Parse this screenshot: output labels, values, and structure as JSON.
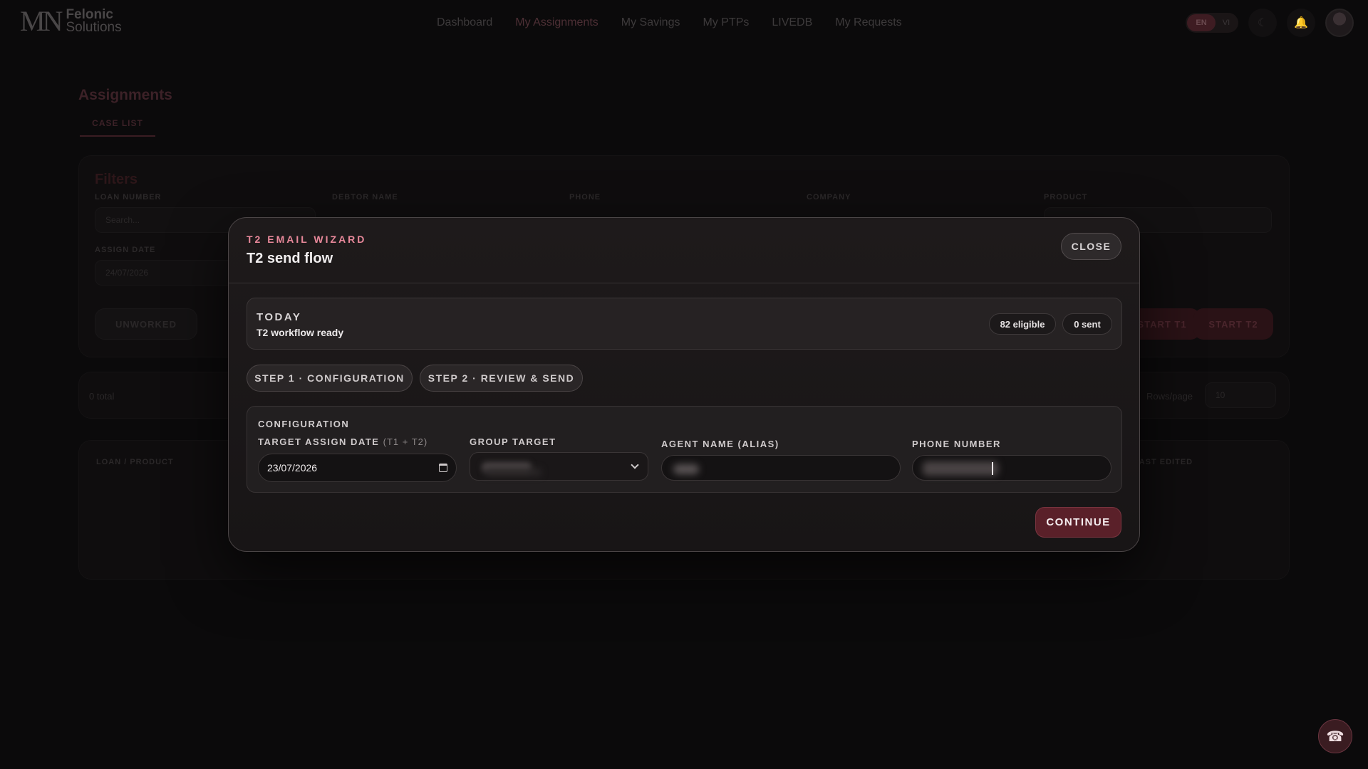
{
  "nav": {
    "logo_mark": "MN",
    "logo_line1": "Felonic",
    "logo_line2": "Solutions",
    "links": [
      "Dashboard",
      "My Assignments",
      "My Savings",
      "My PTPs",
      "LIVEDB",
      "My Requests"
    ],
    "active_link": "My Assignments",
    "lang_active": "EN",
    "lang_other": "VI"
  },
  "background": {
    "page_title": "Assignments",
    "tab_label": "CASE LIST",
    "filters_title": "Filters",
    "labels": [
      "LOAN NUMBER",
      "DEBTOR NAME",
      "PHONE",
      "COMPANY",
      "PRODUCT",
      "ASSIGN DATE"
    ],
    "search_placeholder": "Search...",
    "assign_date": "24/07/2026",
    "unchecked_label": "UNWORKED",
    "start_t1": "START T1",
    "start_t2": "START T2",
    "total_label": "0 total",
    "rows_per_page_label": "Rows/page",
    "rows_per_page_value": "10",
    "col_loan_product": "LOAN / PRODUCT",
    "col_last_edited": "LAST EDITED"
  },
  "modal": {
    "kicker": "T2 EMAIL WIZARD",
    "title": "T2 send flow",
    "close_label": "CLOSE",
    "today_label": "TODAY",
    "today_status": "T2 workflow ready",
    "eligible_badge": "82 eligible",
    "sent_badge": "0 sent",
    "steps": [
      "STEP 1 · CONFIGURATION",
      "STEP 2 · REVIEW & SEND"
    ],
    "config_title": "CONFIGURATION",
    "fields": {
      "target_date_label": "TARGET ASSIGN DATE",
      "target_date_hint": "(T1 + T2)",
      "target_date_value": "23/07/2026",
      "group_target_label": "GROUP TARGET",
      "agent_name_label": "AGENT NAME (ALIAS)",
      "phone_label": "PHONE NUMBER"
    },
    "continue_label": "CONTINUE"
  },
  "icons": {
    "calendar": "calendar-icon",
    "chevron": "chevron-down-icon",
    "phone_fab": "phone-icon",
    "moon": "moon-icon",
    "bell": "bell-icon"
  },
  "colors": {
    "accent_pink": "#e9899b",
    "primary_button": "#5a2029",
    "modal_bg": "#1e1a1b"
  }
}
